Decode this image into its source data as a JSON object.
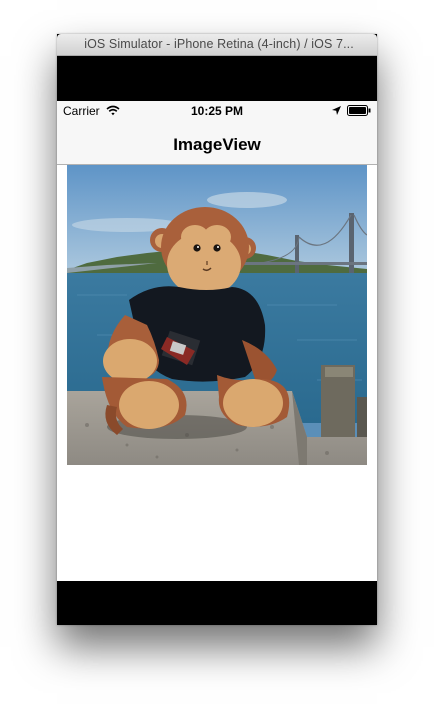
{
  "window": {
    "title": "iOS Simulator - iPhone Retina (4-inch) / iOS 7..."
  },
  "status_bar": {
    "carrier": "Carrier",
    "time": "10:25 PM",
    "icons": [
      "wifi-icon",
      "location-arrow-icon",
      "battery-icon"
    ]
  },
  "nav_bar": {
    "title": "ImageView"
  },
  "image_view": {
    "subject": "plush-monkey-photo"
  }
}
